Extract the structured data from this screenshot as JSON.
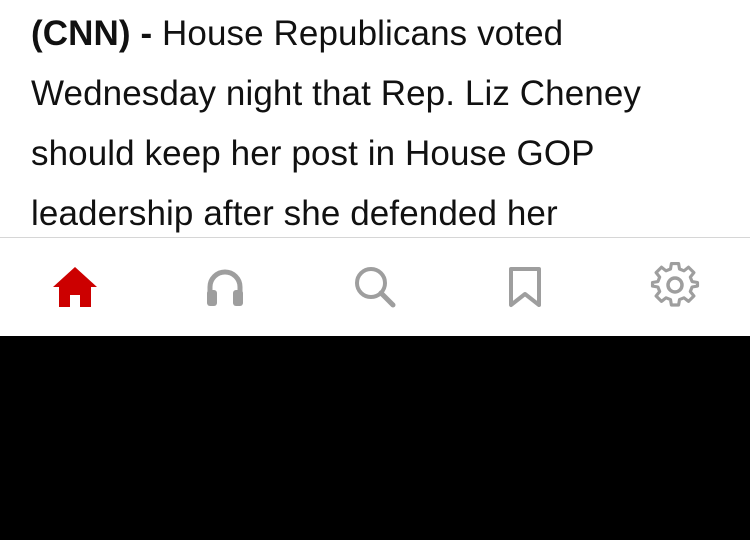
{
  "article": {
    "dateline": "(CNN)",
    "separator": " - ",
    "text": "House Republicans voted Wednesday night that Rep. Liz Cheney should keep her post in House GOP leadership after she defended her"
  },
  "tabbar": {
    "tabs": [
      {
        "icon": "home-icon",
        "active": true
      },
      {
        "icon": "headphones-icon",
        "active": false
      },
      {
        "icon": "search-icon",
        "active": false
      },
      {
        "icon": "bookmark-icon",
        "active": false
      },
      {
        "icon": "gear-icon",
        "active": false
      }
    ]
  },
  "colors": {
    "active": "#cc0000",
    "inactive": "#9e9e9e",
    "text": "#111111",
    "background": "#ffffff",
    "divider": "#d6d6d6"
  }
}
